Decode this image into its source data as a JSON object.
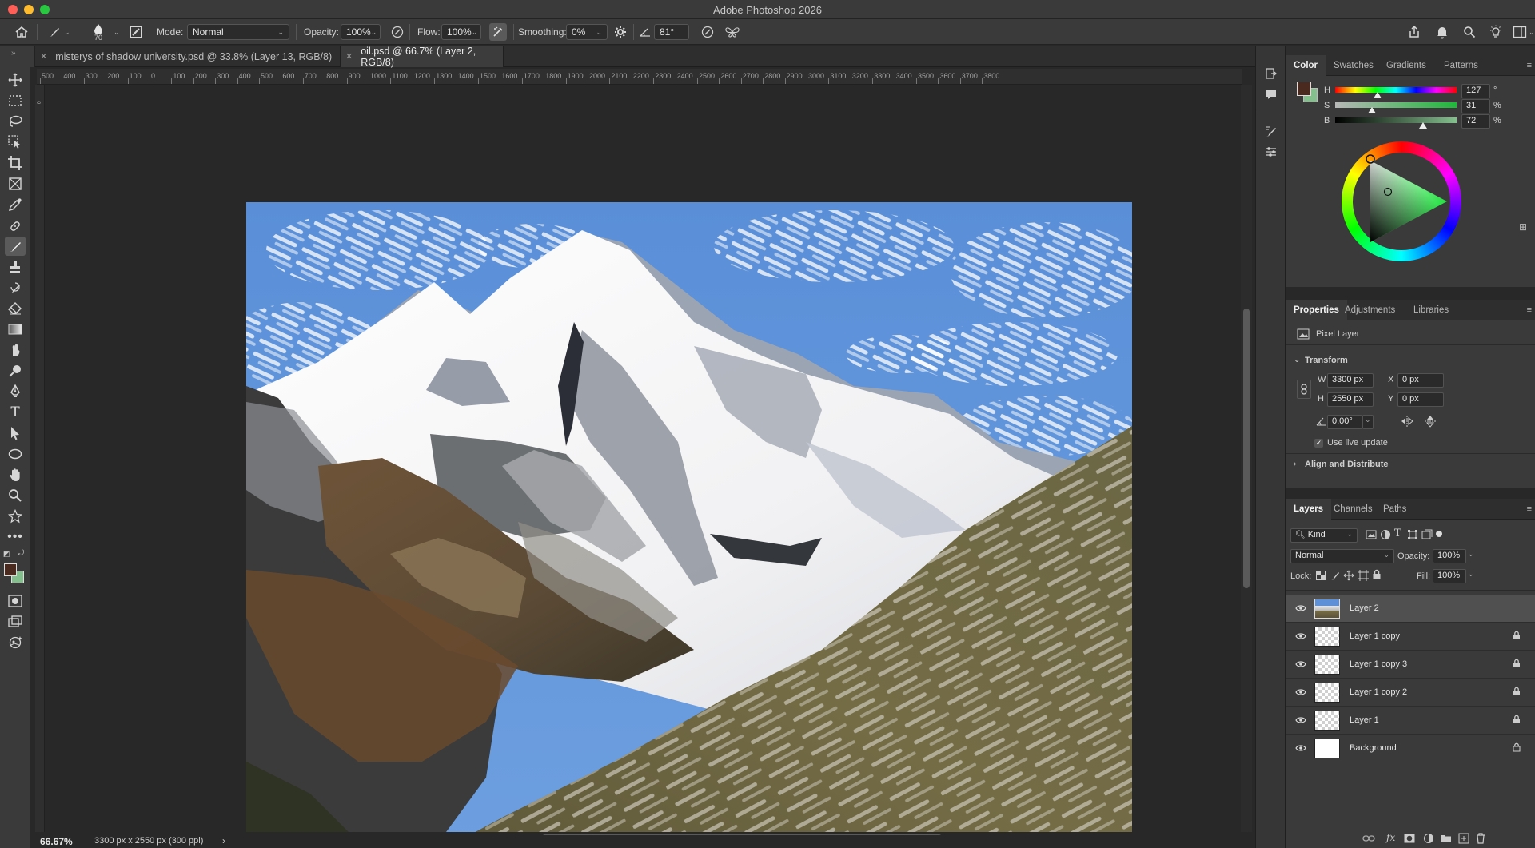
{
  "window": {
    "title": "Adobe Photoshop 2026"
  },
  "options_bar": {
    "brush_size": "70",
    "mode_label": "Mode:",
    "mode_value": "Normal",
    "opacity_label": "Opacity:",
    "opacity_value": "100%",
    "flow_label": "Flow:",
    "flow_value": "100%",
    "smoothing_label": "Smoothing:",
    "smoothing_value": "0%",
    "angle_value": "81°"
  },
  "documents": {
    "tabs": [
      {
        "label": "misterys of shadow university.psd @ 33.8% (Layer 13, RGB/8)"
      },
      {
        "label": "oil.psd @ 66.7% (Layer 2, RGB/8)"
      }
    ]
  },
  "ruler": {
    "ticks": [
      "500",
      "400",
      "300",
      "200",
      "100",
      "0",
      "100",
      "200",
      "300",
      "400",
      "500",
      "600",
      "700",
      "800",
      "900",
      "1000",
      "1100",
      "1200",
      "1300",
      "1400",
      "1500",
      "1600",
      "1700",
      "1800",
      "1900",
      "2000",
      "2100",
      "2200",
      "2300",
      "2400",
      "2500",
      "2600",
      "2700",
      "2800",
      "2900",
      "3000",
      "3100",
      "3200",
      "3300",
      "3400",
      "3500",
      "3600",
      "3700",
      "3800"
    ]
  },
  "status": {
    "zoom": "66.67%",
    "doc_info": "3300 px x 2550 px (300 ppi)",
    "arrow": "›"
  },
  "color_panel": {
    "tabs": [
      "Color",
      "Swatches",
      "Gradients",
      "Patterns"
    ],
    "h_label": "H",
    "h_value": "127",
    "h_unit": "°",
    "s_label": "S",
    "s_value": "31",
    "s_unit": "%",
    "b_label": "B",
    "b_value": "72",
    "b_unit": "%",
    "foreground": "#4a2a1f",
    "background": "#84c08e"
  },
  "properties_panel": {
    "tabs": [
      "Properties",
      "Adjustments",
      "Libraries"
    ],
    "layer_type": "Pixel Layer",
    "transform_label": "Transform",
    "w_label": "W",
    "w_value": "3300 px",
    "h_label": "H",
    "h_value": "2550 px",
    "x_label": "X",
    "x_value": "0 px",
    "y_label": "Y",
    "y_value": "0 px",
    "angle_value": "0.00°",
    "live_update": "Use live update",
    "align_label": "Align and Distribute"
  },
  "layers_panel": {
    "tabs": [
      "Layers",
      "Channels",
      "Paths"
    ],
    "kind_label": "Kind",
    "blend_mode": "Normal",
    "opacity_label": "Opacity:",
    "opacity_value": "100%",
    "lock_label": "Lock:",
    "fill_label": "Fill:",
    "fill_value": "100%",
    "layers": [
      {
        "name": "Layer 2"
      },
      {
        "name": "Layer 1 copy"
      },
      {
        "name": "Layer 1 copy 3"
      },
      {
        "name": "Layer 1 copy 2"
      },
      {
        "name": "Layer 1"
      },
      {
        "name": "Background"
      }
    ]
  }
}
